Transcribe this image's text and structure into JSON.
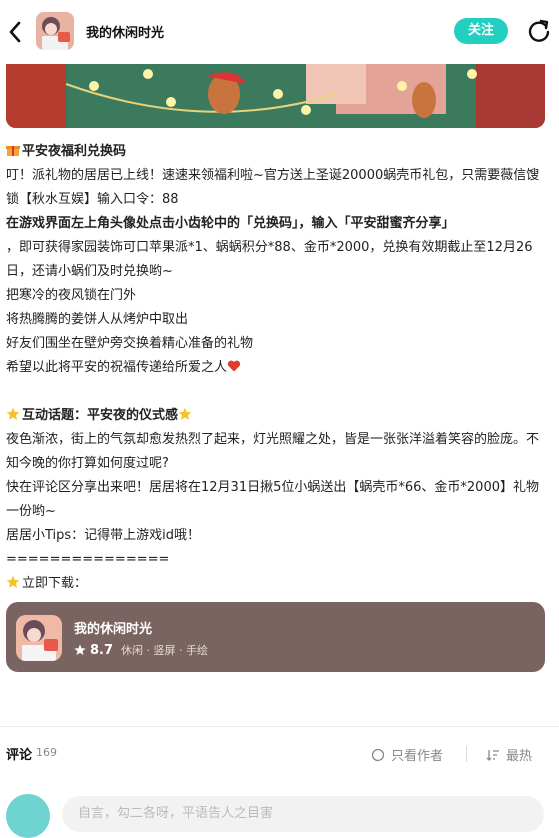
{
  "header": {
    "title": "我的休闲时光",
    "follow_label": "关注"
  },
  "post": {
    "lines": [
      {
        "text": "平安夜福利兑换码",
        "bold": true,
        "icon": "gift-icon"
      },
      {
        "text": "叮！派礼物的居居已上线！速速来领福利啦~官方送上圣诞20000蜗壳币礼包，只需要薇信馊锁【秋水互娱】输入口令：88"
      },
      {
        "text": "在游戏界面左上角头像处点击小齿轮中的「兑换码」，输入「平安甜蜜齐分享」",
        "bold": true
      },
      {
        "text": "，即可获得家园装饰可口苹果派*1、蜗蜗积分*88、金币*2000，兑换有效期截止至12月26日，还请小蜗们及时兑换哟~"
      },
      {
        "text": "把寒冷的夜风锁在门外"
      },
      {
        "text": "将热腾腾的姜饼人从烤炉中取出"
      },
      {
        "text": "好友们围坐在壁炉旁交换着精心准备的礼物"
      },
      {
        "text": "希望以此将平安的祝福传递给所爱之人",
        "icon_after": "heart-icon"
      },
      {
        "text": ""
      },
      {
        "text": "互动话题：平安夜的仪式感",
        "bold": true,
        "icon": "star-icon",
        "icon_after": "star-icon"
      },
      {
        "text": "夜色渐浓，街上的气氛却愈发热烈了起来，灯光照耀之处，皆是一张张洋溢着笑容的脸庞。不知今晚的你打算如何度过呢?"
      },
      {
        "text": "快在评论区分享出来吧！居居将在12月31日揪5位小蜗送出【蜗壳币*66、金币*2000】礼物一份哟~"
      },
      {
        "text": "居居小Tips：记得带上游戏id哦！"
      },
      {
        "text": "==============="
      },
      {
        "text": "立即下载：",
        "icon": "star-icon"
      }
    ]
  },
  "app_card": {
    "name": "我的休闲时光",
    "rating": "8.7",
    "tags": "休闲 · 竖屏 · 手绘"
  },
  "comments": {
    "title": "评论",
    "count": "169",
    "author_only_label": "只看作者",
    "sort_label": "最热"
  },
  "input": {
    "placeholder": "自言，勾二各呀，平语告人之目害"
  },
  "colors": {
    "accent": "#22cfc0",
    "card_bg": "#7a6462"
  }
}
